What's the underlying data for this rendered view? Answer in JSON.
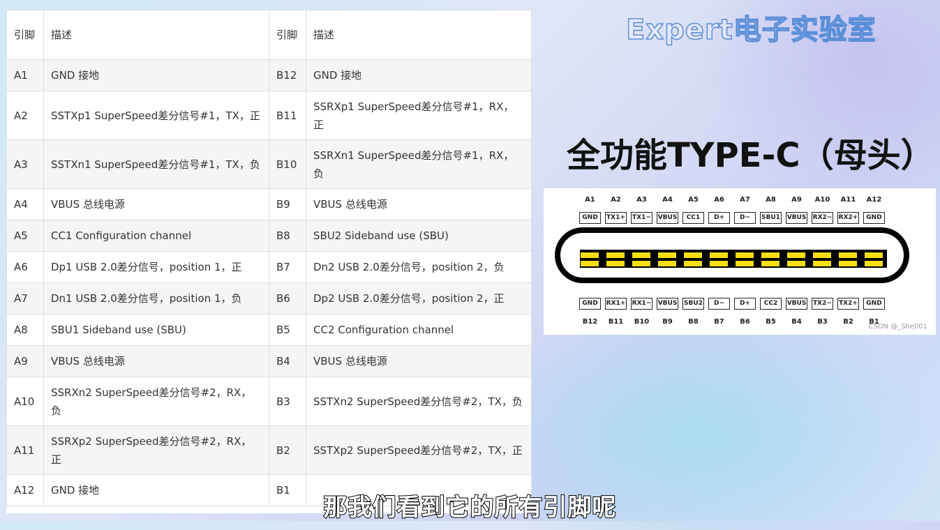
{
  "brand": "Expert电子实验室",
  "headline": "全功能TYPE-C（母头）",
  "subtitle": "那我们看到它的所有引脚呢",
  "table": {
    "headers": [
      "引脚",
      "描述",
      "引脚",
      "描述"
    ],
    "rows": [
      {
        "a_pin": "A1",
        "a_desc": "GND 接地",
        "b_pin": "B12",
        "b_desc": "GND 接地"
      },
      {
        "a_pin": "A2",
        "a_desc": "SSTXp1 SuperSpeed差分信号#1，TX，正",
        "b_pin": "B11",
        "b_desc": "SSRXp1 SuperSpeed差分信号#1，RX，正"
      },
      {
        "a_pin": "A3",
        "a_desc": "SSTXn1 SuperSpeed差分信号#1，TX，负",
        "b_pin": "B10",
        "b_desc": "SSRXn1 SuperSpeed差分信号#1，RX，负"
      },
      {
        "a_pin": "A4",
        "a_desc": "VBUS 总线电源",
        "b_pin": "B9",
        "b_desc": "VBUS 总线电源"
      },
      {
        "a_pin": "A5",
        "a_desc": "CC1 Configuration channel",
        "b_pin": "B8",
        "b_desc": "SBU2 Sideband use (SBU)"
      },
      {
        "a_pin": "A6",
        "a_desc": "Dp1 USB 2.0差分信号，position 1，正",
        "b_pin": "B7",
        "b_desc": "Dn2 USB 2.0差分信号，position 2，负"
      },
      {
        "a_pin": "A7",
        "a_desc": "Dn1 USB 2.0差分信号，position 1，负",
        "b_pin": "B6",
        "b_desc": "Dp2 USB 2.0差分信号，position 2，正"
      },
      {
        "a_pin": "A8",
        "a_desc": "SBU1 Sideband use (SBU)",
        "b_pin": "B5",
        "b_desc": "CC2 Configuration channel"
      },
      {
        "a_pin": "A9",
        "a_desc": "VBUS 总线电源",
        "b_pin": "B4",
        "b_desc": "VBUS 总线电源"
      },
      {
        "a_pin": "A10",
        "a_desc": "SSRXn2 SuperSpeed差分信号#2，RX，负",
        "b_pin": "B3",
        "b_desc": "SSTXn2 SuperSpeed差分信号#2，TX，负"
      },
      {
        "a_pin": "A11",
        "a_desc": "SSRXp2 SuperSpeed差分信号#2，RX，正",
        "b_pin": "B2",
        "b_desc": "SSTXp2 SuperSpeed差分信号#2，TX，正"
      },
      {
        "a_pin": "A12",
        "a_desc": "GND 接地",
        "b_pin": "B1",
        "b_desc": ""
      }
    ]
  },
  "diagram": {
    "top_numbers": [
      "A1",
      "A2",
      "A3",
      "A4",
      "A5",
      "A6",
      "A7",
      "A8",
      "A9",
      "A10",
      "A11",
      "A12"
    ],
    "top_signals": [
      "GND",
      "TX1+",
      "TX1−",
      "VBUS",
      "CC1",
      "D+",
      "D−",
      "SBU1",
      "VBUS",
      "RX2−",
      "RX2+",
      "GND"
    ],
    "bottom_signals": [
      "GND",
      "RX1+",
      "RX1−",
      "VBUS",
      "SBU2",
      "D−",
      "D+",
      "CC2",
      "VBUS",
      "TX2−",
      "TX2+",
      "GND"
    ],
    "bottom_numbers": [
      "B12",
      "B11",
      "B10",
      "B9",
      "B8",
      "B7",
      "B6",
      "B5",
      "B4",
      "B3",
      "B2",
      "B1"
    ],
    "watermark": "CSDN @_She001"
  }
}
